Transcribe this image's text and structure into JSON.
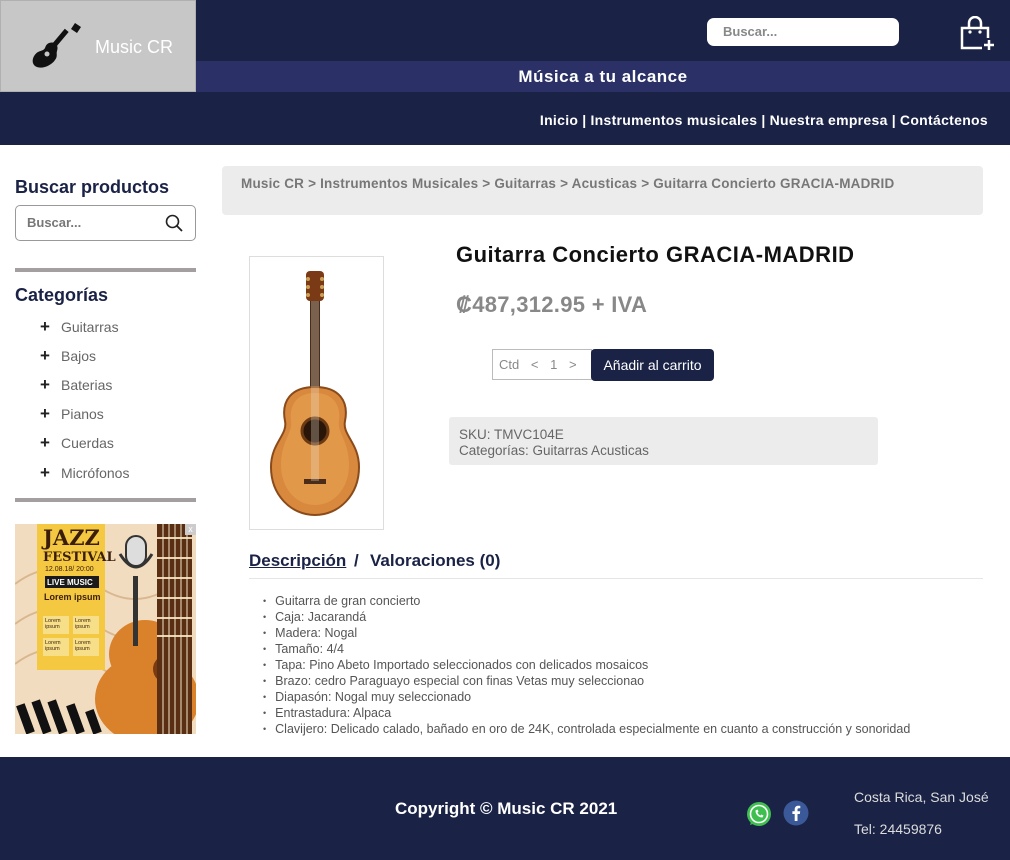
{
  "header": {
    "logo_text": "Music CR",
    "search_placeholder": "Buscar...",
    "slogan": "Música a tu alcance"
  },
  "nav": {
    "items": [
      "Inicio",
      "Instrumentos musicales",
      "Nuestra empresa",
      "Contáctenos"
    ],
    "separator": "|"
  },
  "sidebar": {
    "search_title": "Buscar productos",
    "search_placeholder": "Buscar...",
    "categories_title": "Categorías",
    "categories": [
      "Guitarras",
      "Bajos",
      "Baterias",
      "Pianos",
      "Cuerdas",
      "Micrófonos"
    ]
  },
  "ad": {
    "close": "x",
    "line1": "JAZZ",
    "line2": "FESTIVAL",
    "date": "12.08.18/ 20:00",
    "badge": "LIVE MUSIC",
    "lorem": "Lorem ipsum",
    "small1": "Lorem ipsum",
    "small2": "Lorem ipsum",
    "small3": "Lorem ipsum",
    "small4": "Lorem ipsum"
  },
  "breadcrumb": {
    "items": [
      "Music CR",
      "Instrumentos Musicales",
      "Guitarras",
      "Acusticas",
      "Guitarra Concierto GRACIA-MADRID"
    ],
    "separator": ">"
  },
  "product": {
    "title": "Guitarra Concierto GRACIA-MADRID",
    "price": "₡487,312.95 + IVA",
    "qty_label": "Ctd",
    "qty_dec": "<",
    "qty_value": "1",
    "qty_inc": ">",
    "add_to_cart": "Añadir al carrito",
    "sku": "SKU: TMVC104E",
    "categories": "Categorías: Guitarras Acusticas"
  },
  "tabs": {
    "description": "Descripción",
    "separator": "/",
    "reviews": "Valoraciones (0)"
  },
  "description_items": [
    "Guitarra de gran concierto",
    "Caja: Jacarandá",
    "Madera: Nogal",
    "Tamaño: 4/4",
    "Tapa: Pino Abeto Importado seleccionados con delicados mosaicos",
    "Brazo: cedro Paraguayo especial con finas Vetas muy seleccionao",
    "Diapasón: Nogal muy seleccionado",
    "Entrastadura: Alpaca",
    "Clavijero: Delicado calado, bañado en oro de 24K, controlada especialmente en cuanto a construcción y sonoridad"
  ],
  "footer": {
    "copyright": "Copyright © Music CR 2021",
    "location": "Costa Rica, San José",
    "phone": "Tel: 24459876"
  },
  "colors": {
    "navy": "#1a2246",
    "slogan_bar": "#2b3166",
    "logo_bg": "#c7c7c7"
  }
}
